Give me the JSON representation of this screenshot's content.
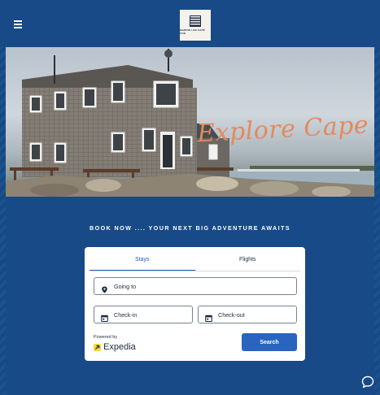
{
  "brand": {
    "logo_text": "MARINE LAB CAPE COD"
  },
  "hero": {
    "script_title": "Explore Cape Cod"
  },
  "tagline": "BOOK NOW .... YOUR NEXT BIG ADVENTURE AWAITS",
  "booking": {
    "tabs": [
      {
        "label": "Stays",
        "active": true
      },
      {
        "label": "Flights",
        "active": false
      }
    ],
    "destination_label": "Going to",
    "checkin_label": "Check-in",
    "checkout_label": "Check-out",
    "powered_by": "Powered by",
    "provider": "Expedia",
    "search_label": "Search"
  },
  "colors": {
    "background": "#174a86",
    "accent_button": "#2864c0",
    "active_tab": "#1f5fb8",
    "script_title": "#e38a5c",
    "expedia_yellow": "#fddb32"
  },
  "icons": [
    "menu-icon",
    "location-pin-icon",
    "calendar-icon",
    "expedia-arrow-icon",
    "chat-icon"
  ]
}
